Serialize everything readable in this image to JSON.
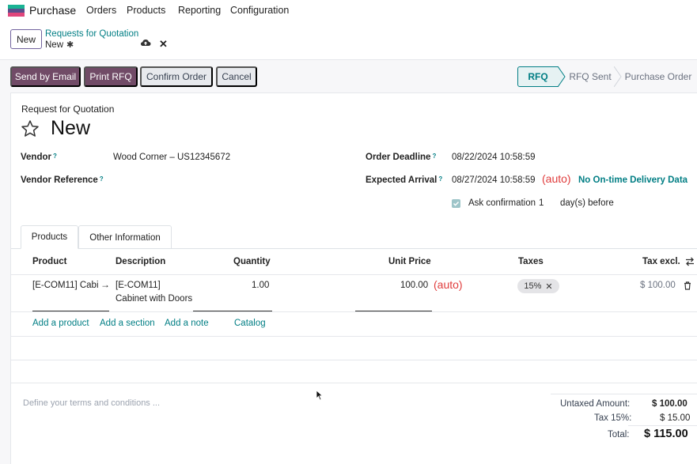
{
  "topnav": {
    "app_name": "Purchase",
    "menu": [
      "Orders",
      "Products",
      "Reporting",
      "Configuration"
    ]
  },
  "control_panel": {
    "new_label": "New",
    "breadcrumb_parent": "Requests for Quotation",
    "breadcrumb_current": "New"
  },
  "actions": {
    "send_email": "Send by Email",
    "print_rfq": "Print RFQ",
    "confirm": "Confirm Order",
    "cancel": "Cancel"
  },
  "statusbar": {
    "stages": [
      "RFQ",
      "RFQ Sent",
      "Purchase Order"
    ],
    "current": "RFQ"
  },
  "form": {
    "subtitle": "Request for Quotation",
    "title": "New",
    "vendor_label": "Vendor",
    "vendor_value": "Wood Corner – US12345672",
    "vendor_ref_label": "Vendor Reference",
    "help_mark": "?",
    "deadline_label": "Order Deadline",
    "deadline_value": "08/22/2024 10:58:59",
    "expected_label": "Expected Arrival",
    "expected_value": "08/27/2024 10:58:59",
    "auto_note": "(auto)",
    "ontime_link": "No On-time Delivery Data",
    "ask_confirmation_label": "Ask confirmation",
    "ask_confirmation_days": "1",
    "days_before": "day(s) before"
  },
  "tabs": [
    "Products",
    "Other Information"
  ],
  "lines": {
    "headers": [
      "Product",
      "Description",
      "Quantity",
      "Unit Price",
      "Taxes",
      "Tax excl."
    ],
    "rows": [
      {
        "product": "[E-COM11] Cabi",
        "description_1": "[E-COM11]",
        "description_2": "Cabinet with Doors",
        "quantity": "1.00",
        "unit_price": "100.00",
        "unit_price_note": "(auto)",
        "tax": "15%",
        "subtotal": "$ 100.00"
      }
    ],
    "add_product": "Add a product",
    "add_section": "Add a section",
    "add_note": "Add a note",
    "catalog": "Catalog"
  },
  "terms_placeholder": "Define your terms and conditions ...",
  "totals": {
    "untaxed_label": "Untaxed Amount:",
    "untaxed_value": "$ 100.00",
    "tax_label": "Tax 15%:",
    "tax_value": "$ 15.00",
    "total_label": "Total:",
    "total_value": "$ 115.00"
  },
  "colors": {
    "brand": "#714b67",
    "link": "#017e84",
    "annotation": "#e03c3c"
  }
}
